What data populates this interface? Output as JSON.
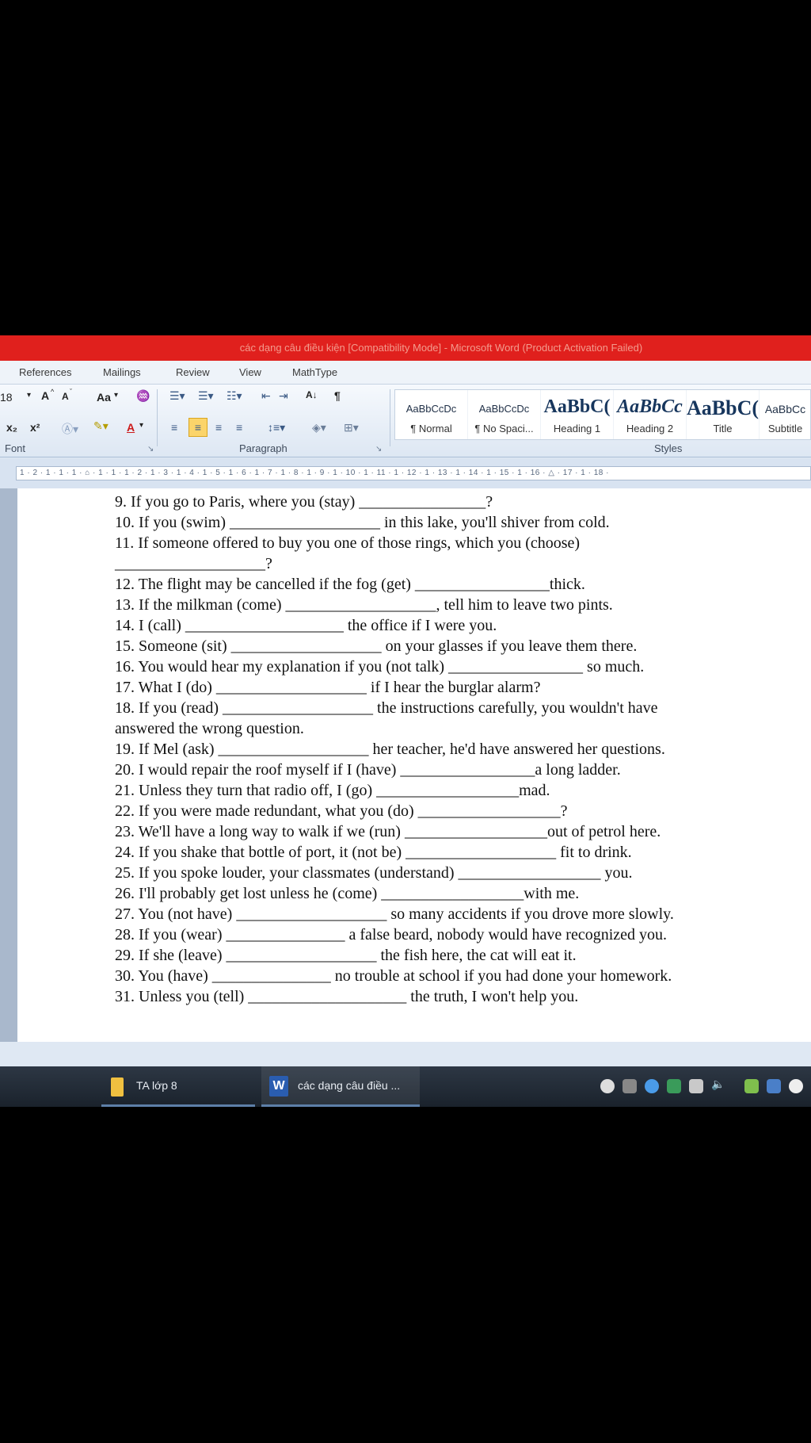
{
  "window": {
    "title": "các dạng câu điều kiện [Compatibility Mode] - Microsoft Word (Product Activation Failed)"
  },
  "ribbon": {
    "tabs": [
      "References",
      "Mailings",
      "Review",
      "View",
      "MathType"
    ],
    "font_size": "18",
    "font_group_label": "Font",
    "paragraph_group_label": "Paragraph",
    "styles_group_label": "Styles",
    "styles": [
      {
        "sample": "AaBbCcDc",
        "name": "¶ Normal"
      },
      {
        "sample": "AaBbCcDc",
        "name": "¶ No Spaci..."
      },
      {
        "sample": "AaBbC(",
        "name": "Heading 1"
      },
      {
        "sample": "AaBbCc",
        "name": "Heading 2"
      },
      {
        "sample": "AaBbC(",
        "name": "Title"
      },
      {
        "sample": "AaBbCc",
        "name": "Subtitle"
      }
    ]
  },
  "ruler": {
    "text": "1 · 2 · 1 · 1 · 1 · ⌂ · 1 · 1 · 1 · 2 · 1 · 3 · 1 · 4 · 1 · 5 · 1 · 6 · 1 · 7 · 1 · 8 · 1 · 9 · 1 · 10 · 1 · 11 · 1 · 12 · 1 · 13 · 1 · 14 · 1 · 15 · 1 · 16 · △ · 17 · 1 · 18 ·"
  },
  "document": {
    "lines": [
      "9. If you go to Paris, where you (stay) ________________?",
      "10. If you (swim) ___________________ in this lake, you'll shiver from cold.",
      "11. If someone offered to buy you one of those rings, which you (choose)",
      "___________________?",
      "12. The flight may be cancelled if the fog (get) _________________thick.",
      "13. If the milkman (come) ___________________, tell him to leave two pints.",
      "14. I (call) ____________________ the office if I were you.",
      "15. Someone (sit) ___________________ on your glasses if you leave them there.",
      "16. You would hear my explanation if you (not talk) _________________ so much.",
      "17. What I (do) ___________________ if I hear the burglar alarm?",
      "18. If you (read) ___________________ the instructions carefully, you wouldn't have",
      "answered the wrong question.",
      "19. If Mel (ask) ___________________ her teacher, he'd have answered her questions.",
      "20. I would repair the roof myself if I (have) _________________a long ladder.",
      "21. Unless they turn that radio off, I (go) __________________mad.",
      "22. If you were made redundant, what you (do) __________________?",
      "23. We'll have a long way to walk if we (run) __________________out of petrol here.",
      "24. If you shake that bottle of port, it (not be) ___________________ fit to drink.",
      "25. If you spoke louder, your classmates (understand) __________________ you.",
      "26. I'll probably get lost unless he (come) __________________with me.",
      "27. You (not have) ___________________ so many accidents if you drove more slowly.",
      "28. If you (wear) _______________ a false beard, nobody would have recognized you.",
      "29. If she (leave) ___________________ the fish here, the cat will eat it.",
      "30. You (have) _______________ no trouble at school if you had done your homework.",
      "31. Unless you (tell) ____________________ the truth, I won't help you."
    ]
  },
  "taskbar": {
    "items": [
      {
        "label": "TA lớp 8",
        "icon": "folder-icon"
      },
      {
        "label": "các dạng câu điều ...",
        "icon": "word-icon"
      }
    ]
  }
}
